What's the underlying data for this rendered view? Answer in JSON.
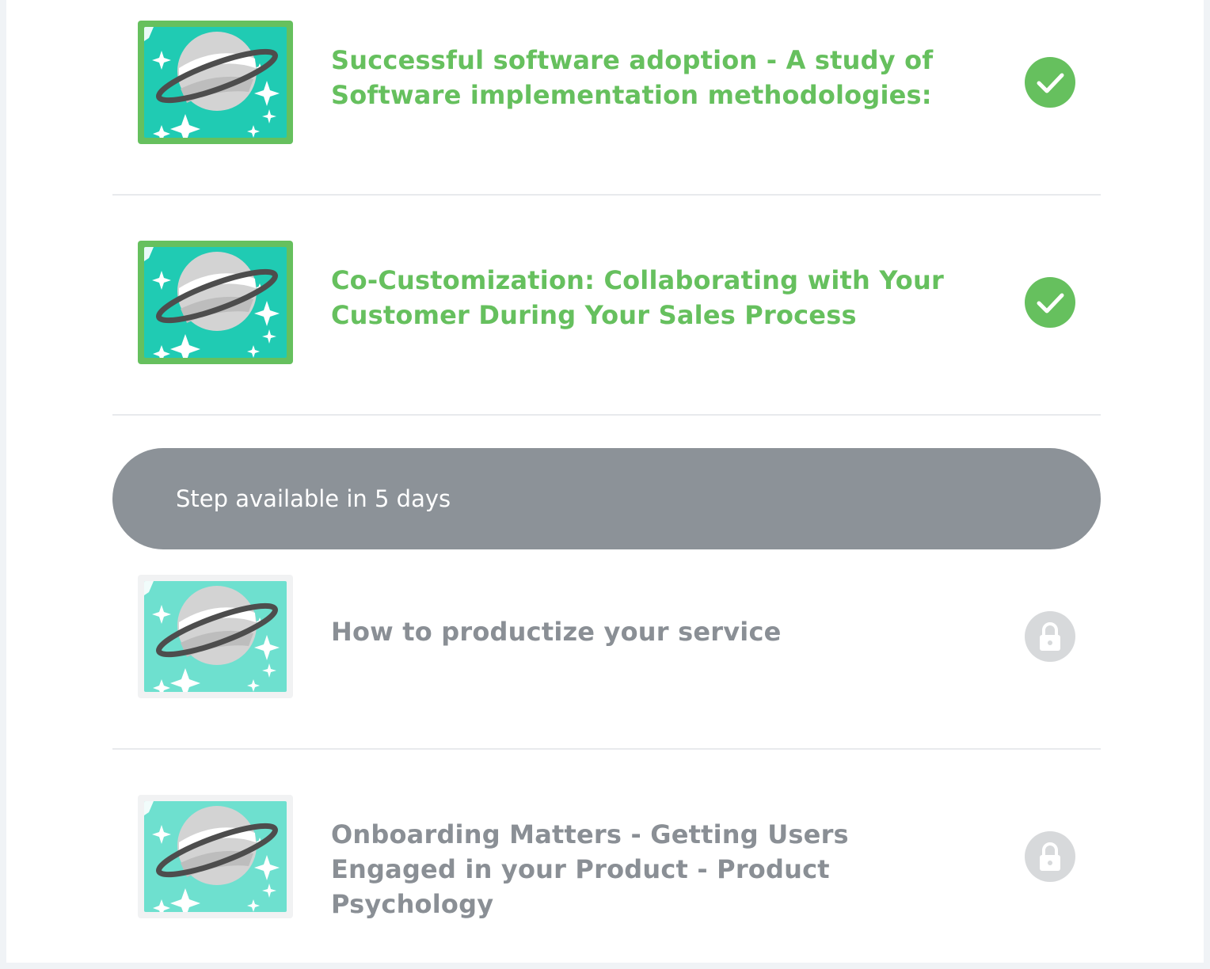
{
  "colors": {
    "completed": "#66c05e",
    "locked_text": "#8a8f95",
    "locked_badge": "#d7d9db",
    "banner": "#8c9298",
    "thumb_bg": "#20cbb3"
  },
  "steps": [
    {
      "title": "Successful software adoption - A study of Software implementation methodologies:",
      "status": "completed",
      "status_icon": "check-icon",
      "thumbnail_icon": "planet-icon"
    },
    {
      "title": "Co-Customization: Collaborating with Your Customer During Your Sales Process",
      "status": "completed",
      "status_icon": "check-icon",
      "thumbnail_icon": "planet-icon"
    },
    {
      "title": "How to productize your service",
      "status": "locked",
      "status_icon": "lock-icon",
      "thumbnail_icon": "planet-icon"
    },
    {
      "title": "Onboarding Matters - Getting Users Engaged in your Product - Product Psychology",
      "status": "locked",
      "status_icon": "lock-icon",
      "thumbnail_icon": "planet-icon"
    }
  ],
  "availability_banner": {
    "text": "Step available in 5 days"
  }
}
